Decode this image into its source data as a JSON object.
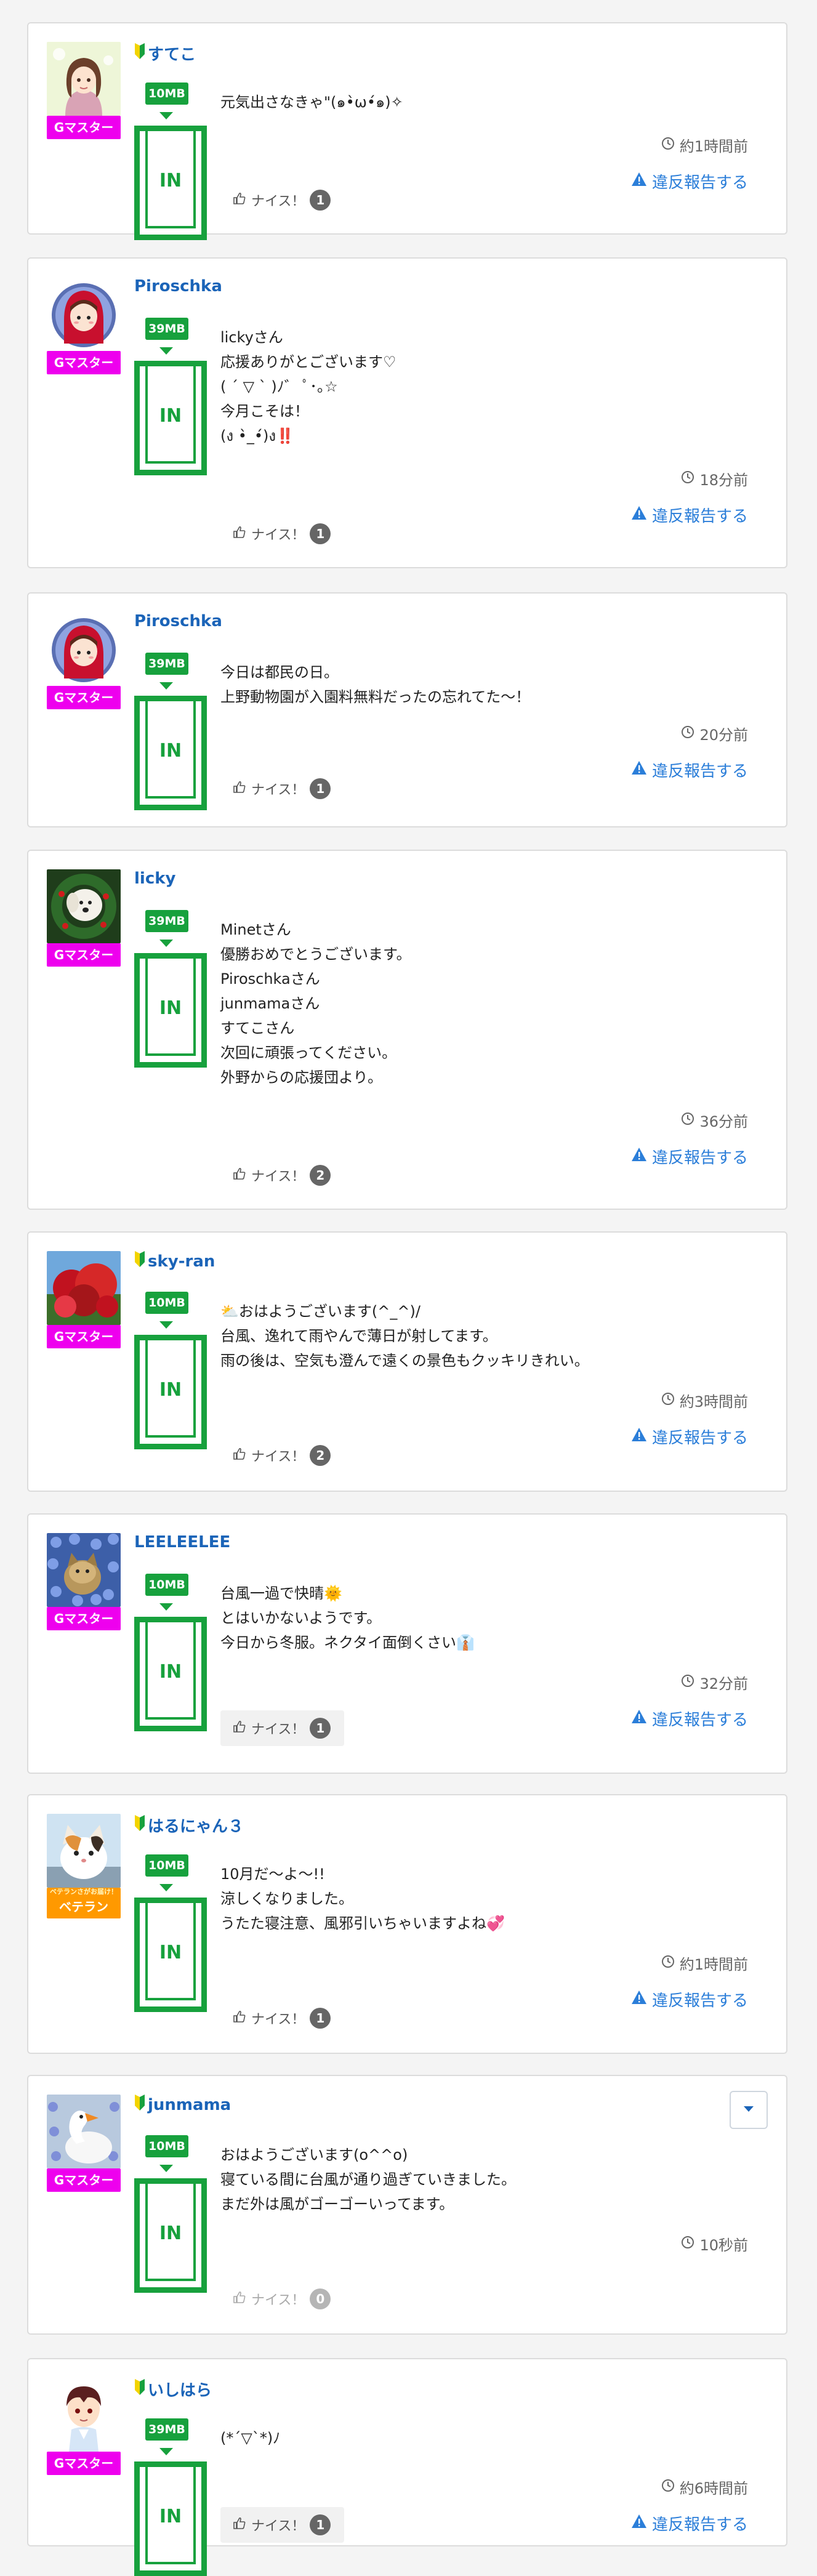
{
  "labels": {
    "in": "IN",
    "nice": "ナイス！",
    "report": "違反報告する"
  },
  "colors": {
    "link_blue": "#1b64b8",
    "report_blue": "#2b7ed9",
    "badge_green": "#17a13d",
    "rank_magenta": "#ee00ee",
    "rank_orange": "#ff9900"
  },
  "posts": [
    {
      "username": "すてこ",
      "beginner": true,
      "rank": "Gマスター",
      "avatar": "girl-illustration",
      "size": "10MB",
      "lines": [
        "元気出さなきゃ\"(๑•̀ω•́๑)✧"
      ],
      "time": "約1時間前",
      "nice_count": "1",
      "report": true
    },
    {
      "username": "Piroschka",
      "beginner": false,
      "rank": "Gマスター",
      "avatar": "red-hood-doll",
      "size": "39MB",
      "lines": [
        "lickyさん",
        "応援ありがとございます♡",
        "( ´ ▽ ` )ﾉ゛ ﾟ･｡☆",
        "今月こそは！",
        "(ง •̀_•́)ง‼️"
      ],
      "time": "18分前",
      "nice_count": "1",
      "report": true
    },
    {
      "username": "Piroschka",
      "beginner": false,
      "rank": "Gマスター",
      "avatar": "red-hood-doll",
      "size": "39MB",
      "lines": [
        "今日は都民の日。",
        "上野動物園が入園料無料だったの忘れてた〜！"
      ],
      "time": "20分前",
      "nice_count": "1",
      "report": true
    },
    {
      "username": "licky",
      "beginner": false,
      "rank": "Gマスター",
      "avatar": "dog-wreath",
      "size": "39MB",
      "lines": [
        "Minetさん",
        "優勝おめでとうございます。",
        "Piroschkaさん",
        "junmamaさん",
        "すてこさん",
        "次回に頑張ってください。",
        "外野からの応援団より。"
      ],
      "time": "36分前",
      "nice_count": "2",
      "report": true
    },
    {
      "username": "sky-ran",
      "beginner": true,
      "rank": "Gマスター",
      "avatar": "red-tree",
      "size": "10MB",
      "lines": [
        "⛅おはようございます(^_^)/",
        "台風、逸れて雨やんで薄日が射してます。",
        "雨の後は、空気も澄んで遠くの景色もクッキリきれい。"
      ],
      "time": "約3時間前",
      "nice_count": "2",
      "report": true
    },
    {
      "username": "LEELEELEE",
      "beginner": false,
      "rank": "Gマスター",
      "avatar": "blue-flowers-cat",
      "size": "10MB",
      "lines": [
        "台風一過で快晴🌞",
        "とはいかないようです。",
        "今日から冬服。ネクタイ面倒くさい👔"
      ],
      "time": "32分前",
      "nice_count": "1",
      "report": true
    },
    {
      "username": "はるにゃん３",
      "beginner": true,
      "rank": "ベテラン",
      "rank_sub": "ベテランさがお届け！",
      "avatar": "calico-cat",
      "size": "10MB",
      "lines": [
        "10月だ〜よ〜!!",
        "涼しくなりました。",
        "うたた寝注意、風邪引いちゃいますよね💞"
      ],
      "time": "約1時間前",
      "nice_count": "1",
      "report": true
    },
    {
      "username": "junmama",
      "beginner": true,
      "rank": "Gマスター",
      "avatar": "swan",
      "size": "10MB",
      "lines": [
        "おはようございます(o^^o)",
        "寝ている間に台風が通り過ぎていきました。",
        "まだ外は風がゴーゴーいってます。"
      ],
      "time": "10秒前",
      "nice_count": "0",
      "report": false
    },
    {
      "username": "いしはら",
      "beginner": true,
      "rank": "Gマスター",
      "avatar": "boy-character",
      "size": "39MB",
      "lines": [
        "(*´▽`*)ﾉ"
      ],
      "time": "約6時間前",
      "nice_count": "1",
      "report": true
    }
  ]
}
